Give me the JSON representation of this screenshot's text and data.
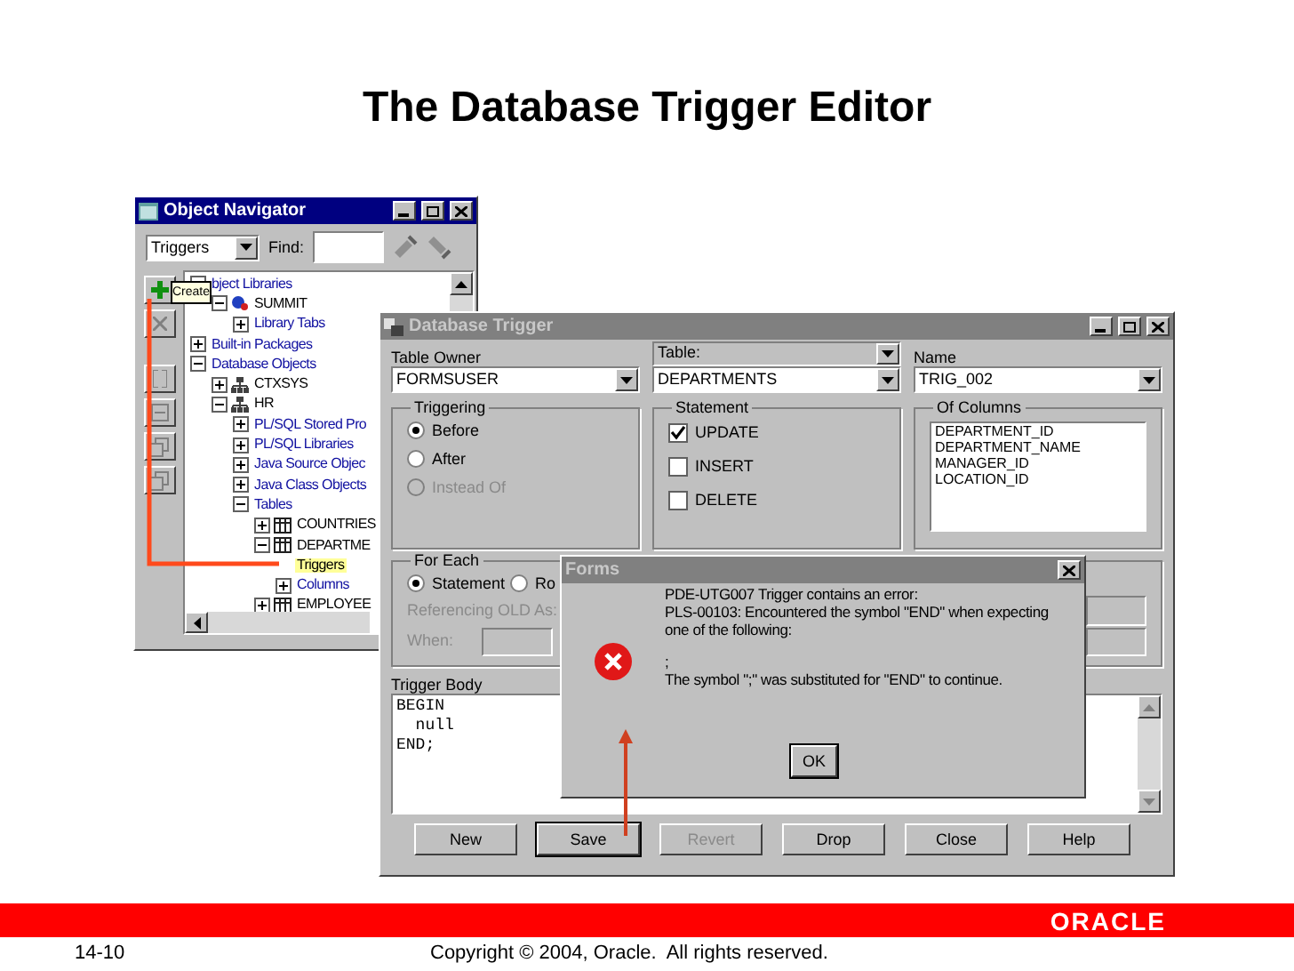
{
  "slide_title": "The Database Trigger Editor",
  "navigator": {
    "title": "Object Navigator",
    "active": true,
    "view": "Triggers",
    "find_label": "Find:",
    "tooltip": "Create",
    "tree": [
      {
        "label": "bject Libraries",
        "kind": "node",
        "expanded": true,
        "selected": false,
        "children": [
          {
            "label": "SUMMIT",
            "kind": "library",
            "expanded": true,
            "selected": false,
            "children": [
              {
                "label": "Library Tabs",
                "kind": "node",
                "expanded": false,
                "selected": false
              }
            ]
          }
        ]
      },
      {
        "label": "Built-in Packages",
        "kind": "node",
        "expanded": false,
        "selected": false
      },
      {
        "label": "Database Objects",
        "kind": "node",
        "expanded": true,
        "selected": false,
        "children": [
          {
            "label": "CTXSYS",
            "kind": "schema",
            "expanded": false,
            "selected": false
          },
          {
            "label": "HR",
            "kind": "schema",
            "expanded": true,
            "selected": false,
            "children": [
              {
                "label": "PL/SQL Stored Pro",
                "kind": "node",
                "expanded": false,
                "selected": false
              },
              {
                "label": "PL/SQL Libraries",
                "kind": "node",
                "expanded": false,
                "selected": false
              },
              {
                "label": "Java Source Objec",
                "kind": "node",
                "expanded": false,
                "selected": false
              },
              {
                "label": "Java Class Objects",
                "kind": "node",
                "expanded": false,
                "selected": false
              },
              {
                "label": "Tables",
                "kind": "node",
                "expanded": true,
                "selected": false,
                "children": [
                  {
                    "label": "COUNTRIES",
                    "kind": "table",
                    "expanded": false,
                    "selected": false
                  },
                  {
                    "label": "DEPARTME",
                    "kind": "table",
                    "expanded": true,
                    "selected": false,
                    "children": [
                      {
                        "label": "Triggers",
                        "kind": "leaf",
                        "selected": true
                      },
                      {
                        "label": "Columns",
                        "kind": "node",
                        "expanded": false,
                        "selected": false
                      }
                    ]
                  },
                  {
                    "label": "EMPLOYEE",
                    "kind": "table",
                    "expanded": false,
                    "selected": false
                  }
                ]
              }
            ]
          }
        ]
      }
    ]
  },
  "trigger_window": {
    "title": "Database Trigger",
    "active": false,
    "table_owner": {
      "label": "Table Owner",
      "value": "FORMSUSER"
    },
    "table": {
      "label": "Table:",
      "value": "DEPARTMENTS"
    },
    "name": {
      "label": "Name",
      "value": "TRIG_002"
    },
    "triggering": {
      "label": "Triggering",
      "options": [
        {
          "label": "Before",
          "selected": true,
          "disabled": false
        },
        {
          "label": "After",
          "selected": false,
          "disabled": false
        },
        {
          "label": "Instead Of",
          "selected": false,
          "disabled": true
        }
      ]
    },
    "statement": {
      "label": "Statement",
      "options": [
        {
          "label": "UPDATE",
          "checked": true
        },
        {
          "label": "INSERT",
          "checked": false
        },
        {
          "label": "DELETE",
          "checked": false
        }
      ]
    },
    "of_columns": {
      "label": "Of Columns",
      "items": [
        "DEPARTMENT_ID",
        "DEPARTMENT_NAME",
        "MANAGER_ID",
        "LOCATION_ID"
      ]
    },
    "for_each": {
      "label": "For Each",
      "options": [
        {
          "label": "Statement",
          "selected": true
        },
        {
          "label": "Ro",
          "selected": false
        }
      ],
      "referencing": {
        "label": "Referencing OLD As:",
        "disabled": true
      },
      "when": {
        "label": "When:",
        "disabled": true
      }
    },
    "body": {
      "label": "Trigger Body",
      "lines": [
        "BEGIN",
        "  null",
        "END;"
      ]
    },
    "buttons": [
      {
        "label": "New",
        "disabled": false,
        "focused": false
      },
      {
        "label": "Save",
        "disabled": false,
        "focused": true
      },
      {
        "label": "Revert",
        "disabled": true,
        "focused": false
      },
      {
        "label": "Drop",
        "disabled": false,
        "focused": false
      },
      {
        "label": "Close",
        "disabled": false,
        "focused": false
      },
      {
        "label": "Help",
        "disabled": false,
        "focused": false
      }
    ]
  },
  "dialog": {
    "title": "Forms",
    "active": false,
    "message": [
      "PDE-UTG007 Trigger contains an error:",
      "PLS-00103: Encountered the symbol \"END\" when expecting one of the following:",
      ";",
      "The symbol \";\" was substituted for \"END\" to continue."
    ],
    "button": "OK"
  },
  "footer": {
    "logo": "ORACLE",
    "page": "14-10",
    "copyright": "Copyright © 2004, Oracle.  All rights reserved."
  }
}
